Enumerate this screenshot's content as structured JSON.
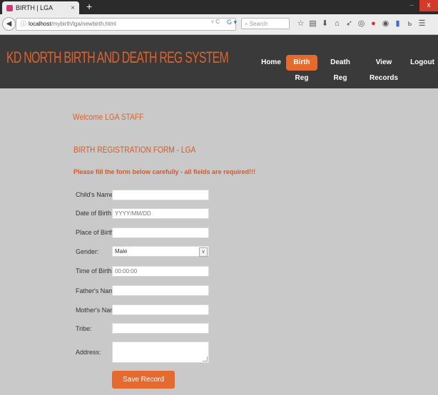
{
  "browser": {
    "tab_title": "BIRTH | LGA",
    "tab_close": "×",
    "new_tab": "+",
    "url_host": "localhost",
    "url_path": "/mybirth/lga/newbirth.html",
    "search_placeholder": "Search",
    "window_close": "x"
  },
  "site": {
    "title": "KD NORTH BIRTH AND DEATH REG SYSTEM",
    "nav": [
      {
        "label": "Home",
        "active": false
      },
      {
        "label": "Birth Reg",
        "active": true
      },
      {
        "label": "Death Reg",
        "active": false
      },
      {
        "label": "View Records",
        "active": false
      },
      {
        "label": "Logout",
        "active": false
      }
    ],
    "accent_color": "#e66a2e"
  },
  "content": {
    "welcome": "Welcome LGA STAFF",
    "form_title": "BIRTH REGISTRATION FORM - LGA",
    "form_note": "Please fill the form below carefully - all fields are required!!!",
    "fields": {
      "child_name": {
        "label": "Child's Name:",
        "value": "",
        "placeholder": ""
      },
      "dob": {
        "label": "Date of Birth:",
        "value": "",
        "placeholder": "YYYY/MM/DD"
      },
      "place_of_birth": {
        "label": "Place of Birth:",
        "value": "",
        "placeholder": ""
      },
      "gender": {
        "label": "Gender:",
        "value": "Male"
      },
      "time_of_birth": {
        "label": "Time of Birth:",
        "value": "",
        "placeholder": "00:00:00"
      },
      "father_name": {
        "label": "Father's Name:",
        "value": "",
        "placeholder": ""
      },
      "mother_name": {
        "label": "Mother's Name:",
        "value": "",
        "placeholder": ""
      },
      "tribe": {
        "label": "Tribe:",
        "value": "",
        "placeholder": ""
      },
      "address": {
        "label": "Address:",
        "value": ""
      }
    },
    "save_label": "Save Record"
  }
}
